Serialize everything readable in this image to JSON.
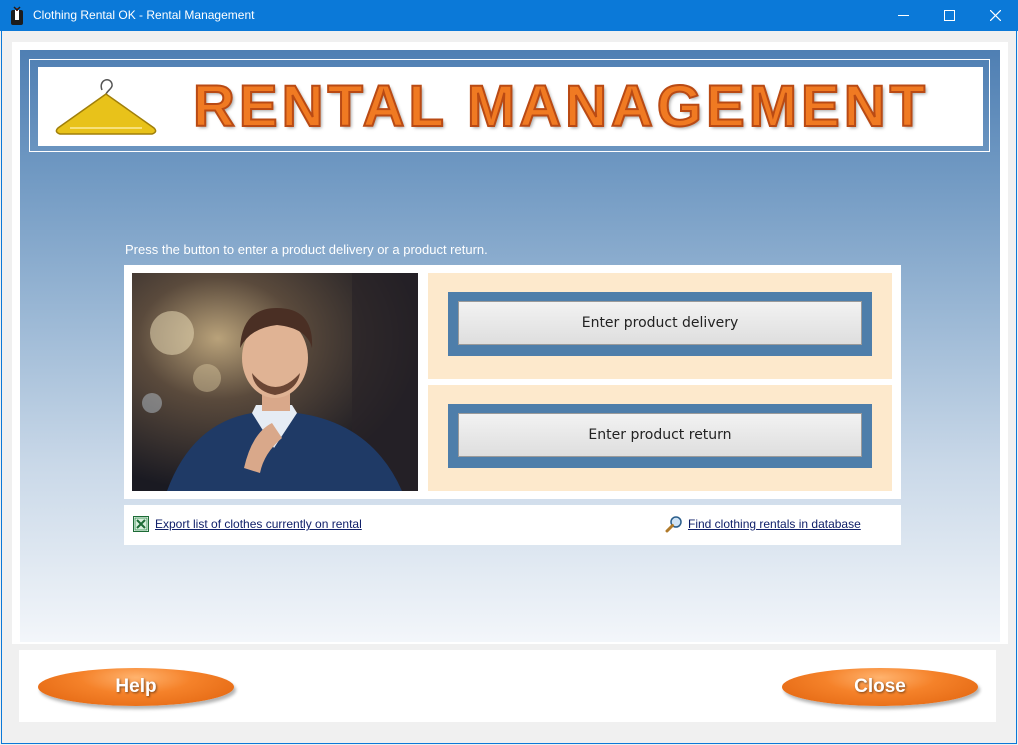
{
  "window": {
    "title": "Clothing Rental OK - Rental Management",
    "controls": [
      "minimize-icon",
      "maximize-icon",
      "close-icon"
    ]
  },
  "banner": {
    "title": "RENTAL MANAGEMENT",
    "logo_icon": "hanger-icon",
    "title_color": "#f07a22"
  },
  "instruction": "Press the button to enter a product delivery or a product return.",
  "actions": {
    "delivery_label": "Enter product delivery",
    "return_label": "Enter product return"
  },
  "links": {
    "export_label": "Export list of clothes currently on rental",
    "find_label": "Find clothing rentals in database"
  },
  "footer": {
    "help_label": "Help",
    "close_label": "Close"
  },
  "colors": {
    "titlebar": "#0b79d8",
    "accent_orange": "#f5822a",
    "panel_blue": "#4e7eaa",
    "cell_bg": "#fde9cc"
  }
}
